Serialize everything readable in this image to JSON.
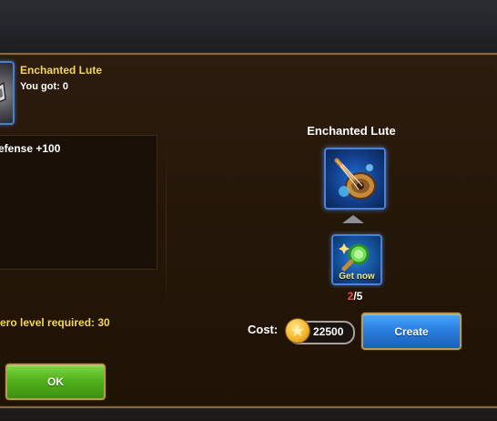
{
  "left_panel": {
    "item_name": "Enchanted Lute",
    "you_got": "You got:  0",
    "stats": [
      "efense +100"
    ],
    "hero_level": "ero level required:  30",
    "ok_label": "OK"
  },
  "right_panel": {
    "item_name": "Enchanted Lute",
    "ingredient_label": "Get now",
    "progress_have": "2",
    "progress_total": "/5",
    "cost_label": "Cost:",
    "cost_value": "22500",
    "create_label": "Create"
  },
  "icons": {
    "item": "enchanted-lute-icon",
    "ingredient": "magnifier-icon",
    "coin": "gold-coin-icon",
    "arrow": "up-arrow-icon"
  },
  "colors": {
    "item_name": "#f2d65a",
    "have_count": "#f04a3a",
    "ok_button": "#51b21c",
    "create_button": "#2b7fe0",
    "frame_border": "#4a82d8"
  }
}
